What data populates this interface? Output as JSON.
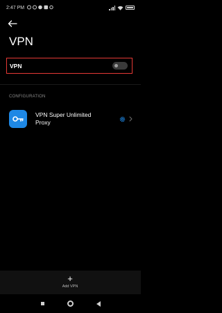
{
  "status_bar": {
    "time": "2:47 PM",
    "icons": [
      "signal-bars-icon",
      "wifi-icon",
      "battery-icon"
    ]
  },
  "header": {
    "back_icon": "arrow-left-icon",
    "title": "VPN"
  },
  "vpn_toggle": {
    "label": "VPN",
    "enabled": false
  },
  "configuration": {
    "section_label": "CONFIGURATION",
    "profiles": [
      {
        "name": "VPN Super Unlimited Proxy",
        "icon": "key-icon",
        "settings_icon": "gear-icon",
        "arrow_icon": "chevron-right-icon"
      }
    ]
  },
  "footer": {
    "add_label": "Add VPN",
    "add_icon": "plus-icon"
  },
  "colors": {
    "background": "#000000",
    "highlight_border": "#e53935",
    "accent": "#1e88e5"
  }
}
